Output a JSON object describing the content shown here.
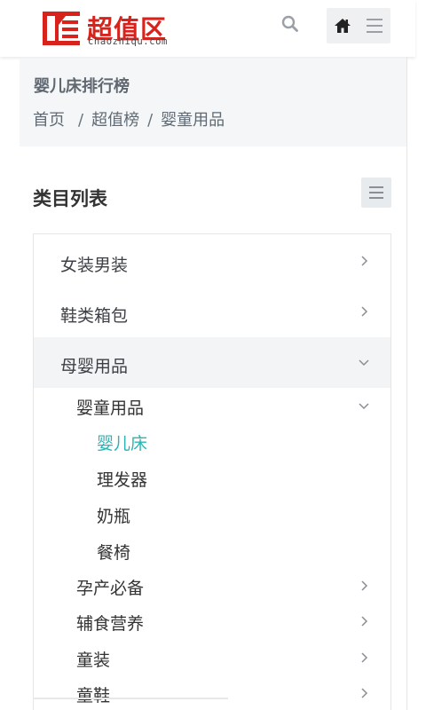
{
  "header": {
    "logo_text": "超值区",
    "logo_domain": "chaozhiqu.com",
    "brand_color": "#d8231d"
  },
  "breadcrumb": {
    "title": "婴儿床排行榜",
    "items": [
      "首页",
      "超值榜",
      "婴童用品"
    ],
    "separator": "/"
  },
  "categories": {
    "title": "类目列表",
    "accent_color": "#2cb4b4",
    "items": [
      {
        "label": "女装男装",
        "icon": "chevron-right-icon"
      },
      {
        "label": "鞋类箱包",
        "icon": "chevron-right-icon"
      },
      {
        "label": "母婴用品",
        "icon": "chevron-down-icon"
      },
      {
        "label": "婴童用品",
        "icon": "chevron-down-icon"
      },
      {
        "label": "婴儿床",
        "state": "selected"
      },
      {
        "label": "理发器"
      },
      {
        "label": "奶瓶"
      },
      {
        "label": "餐椅"
      },
      {
        "label": "孕产必备",
        "icon": "chevron-right-icon"
      },
      {
        "label": "辅食营养",
        "icon": "chevron-right-icon"
      },
      {
        "label": "童装",
        "icon": "chevron-right-icon"
      },
      {
        "label": "童鞋",
        "icon": "chevron-right-icon"
      }
    ]
  }
}
